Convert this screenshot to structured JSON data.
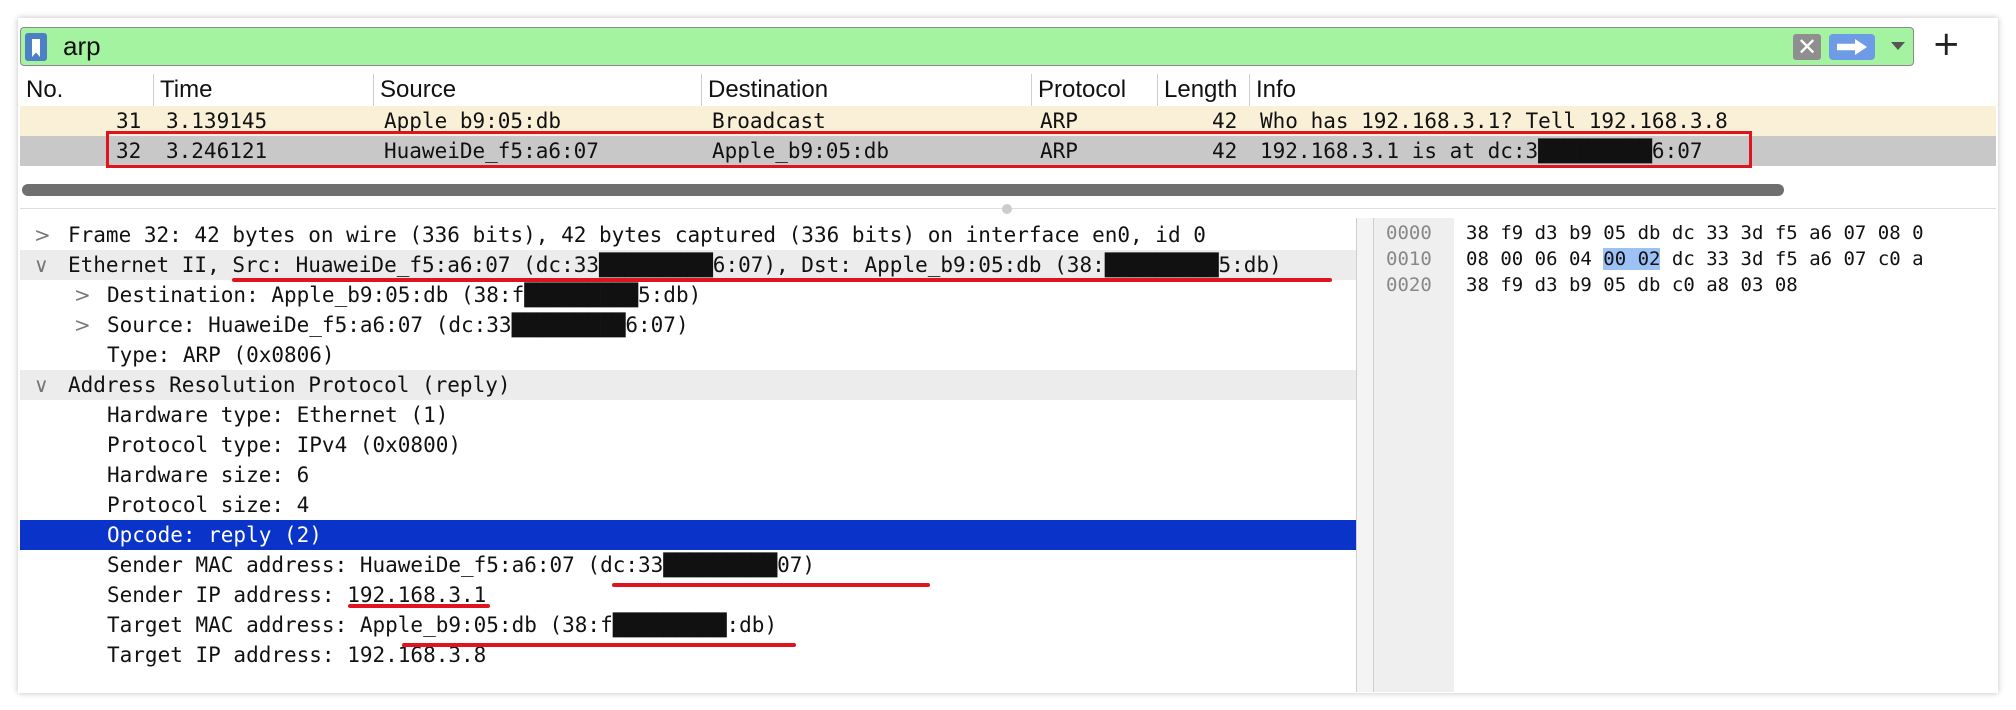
{
  "filter": {
    "value": "arp",
    "icons": [
      "bookmark-icon",
      "clear-icon",
      "apply-arrow-icon",
      "dropdown-icon",
      "plus-icon"
    ],
    "add_label": "+",
    "clear_label": "✕"
  },
  "packet_list": {
    "columns": [
      "No.",
      "Time",
      "Source",
      "Destination",
      "Protocol",
      "Length",
      "Info"
    ],
    "rows": [
      {
        "no": "31",
        "time": "3.139145",
        "source": "Apple_b9:05:db",
        "destination": "Broadcast",
        "protocol": "ARP",
        "length": "42",
        "info": "Who has 192.168.3.1? Tell 192.168.3.8"
      },
      {
        "no": "32",
        "time": "3.246121",
        "source": "HuaweiDe_f5:a6:07",
        "destination": "Apple_b9:05:db",
        "protocol": "ARP",
        "length": "42",
        "info": "192.168.3.1 is at dc:3█████████6:07"
      }
    ]
  },
  "details": {
    "rows": [
      {
        "arrow": ">",
        "text": "Frame 32: 42 bytes on wire (336 bits), 42 bytes captured (336 bits) on interface en0, id 0"
      },
      {
        "arrow": "∨",
        "text": "Ethernet II, Src: HuaweiDe_f5:a6:07 (dc:33█████████6:07), Dst: Apple_b9:05:db (38:█████████5:db)"
      },
      {
        "arrow": ">",
        "text": "Destination: Apple_b9:05:db (38:f█████████5:db)"
      },
      {
        "arrow": ">",
        "text": "Source: HuaweiDe_f5:a6:07 (dc:33█████████6:07)"
      },
      {
        "arrow": "",
        "text": "Type: ARP (0x0806)"
      },
      {
        "arrow": "∨",
        "text": "Address Resolution Protocol (reply)"
      },
      {
        "arrow": "",
        "text": "Hardware type: Ethernet (1)"
      },
      {
        "arrow": "",
        "text": "Protocol type: IPv4 (0x0800)"
      },
      {
        "arrow": "",
        "text": "Hardware size: 6"
      },
      {
        "arrow": "",
        "text": "Protocol size: 4"
      },
      {
        "arrow": "",
        "text": "Opcode: reply (2)"
      },
      {
        "arrow": "",
        "text": "Sender MAC address: HuaweiDe_f5:a6:07 (dc:33█████████07)"
      },
      {
        "arrow": "",
        "text": "Sender IP address: 192.168.3.1"
      },
      {
        "arrow": "",
        "text": "Target MAC address: Apple_b9:05:db (38:f█████████:db)"
      },
      {
        "arrow": "",
        "text": "Target IP address: 192.168.3.8"
      }
    ]
  },
  "hex": {
    "rows": [
      {
        "offset": "0000",
        "pre": "38 f9 d3 b9 05 db dc 33  3d f5 a6 07 08 0",
        "hl": "",
        "post": ""
      },
      {
        "offset": "0010",
        "pre": "08 00 06 04 ",
        "hl": "00 02",
        "post": " dc 33  3d f5 a6 07 c0 a"
      },
      {
        "offset": "0020",
        "pre": "38 f9 d3 b9 05 db c0 a8  03 08",
        "hl": "",
        "post": ""
      }
    ]
  },
  "colors": {
    "filter_bg": "#a3f3a1",
    "selected_row": "#c8c8c8",
    "alt_row": "#faf0d7",
    "selected_detail": "#0a34c9",
    "annotation_red": "#e0141e"
  }
}
